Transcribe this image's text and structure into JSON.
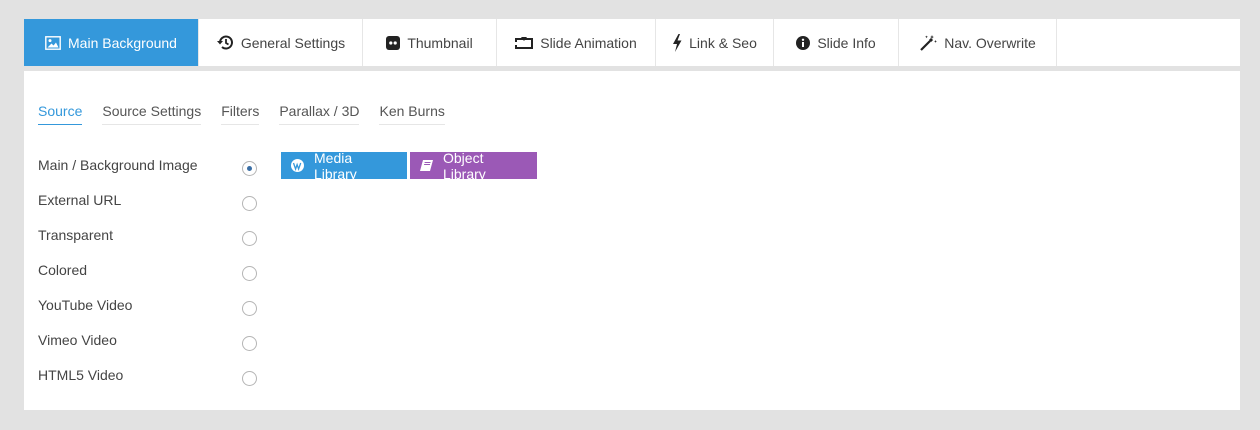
{
  "tabs": [
    {
      "label": "Main Background",
      "icon": "image-icon",
      "active": true
    },
    {
      "label": "General Settings",
      "icon": "history-icon",
      "active": false
    },
    {
      "label": "Thumbnail",
      "icon": "thumbnail-icon",
      "active": false
    },
    {
      "label": "Slide Animation",
      "icon": "animation-icon",
      "active": false
    },
    {
      "label": "Link & Seo",
      "icon": "bolt-icon",
      "active": false
    },
    {
      "label": "Slide Info",
      "icon": "info-icon",
      "active": false
    },
    {
      "label": "Nav. Overwrite",
      "icon": "magic-wand-icon",
      "active": false
    }
  ],
  "subtabs": [
    {
      "label": "Source",
      "active": true
    },
    {
      "label": "Source Settings",
      "active": false
    },
    {
      "label": "Filters",
      "active": false
    },
    {
      "label": "Parallax / 3D",
      "active": false
    },
    {
      "label": "Ken Burns",
      "active": false
    }
  ],
  "sources": [
    {
      "label": "Main / Background Image",
      "selected": true
    },
    {
      "label": "External URL",
      "selected": false
    },
    {
      "label": "Transparent",
      "selected": false
    },
    {
      "label": "Colored",
      "selected": false
    },
    {
      "label": "YouTube Video",
      "selected": false
    },
    {
      "label": "Vimeo Video",
      "selected": false
    },
    {
      "label": "HTML5 Video",
      "selected": false
    }
  ],
  "buttons": {
    "media_library": "Media Library",
    "object_library": "Object Library"
  },
  "colors": {
    "accent": "#3498db",
    "purple": "#9b59b6",
    "background": "#e2e2e2"
  }
}
